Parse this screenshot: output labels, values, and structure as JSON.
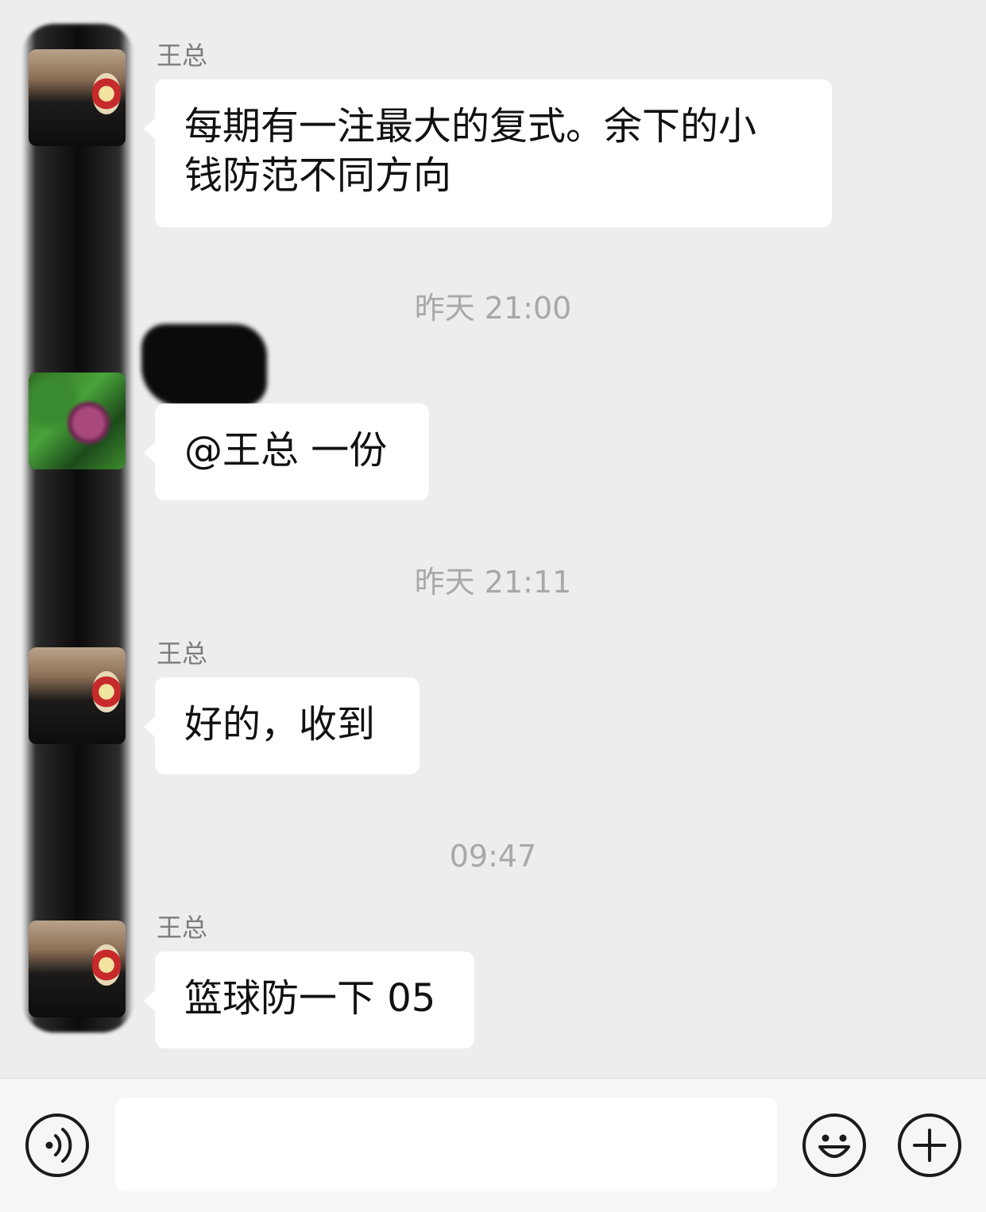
{
  "messages": [
    {
      "sender": "王总",
      "text_line1": "每期有一注最大的复式。余下的小",
      "text_line2": "钱防范不同方向"
    },
    {
      "time": "昨天 21:00"
    },
    {
      "text": "@王总 一份"
    },
    {
      "time": "昨天 21:11"
    },
    {
      "sender": "王总",
      "text": "好的，收到"
    },
    {
      "time": "09:47"
    },
    {
      "sender": "王总",
      "text": "篮球防一下 05"
    }
  ],
  "input_bar": {
    "input_value": "",
    "voice_icon": "voice-icon",
    "emoji_icon": "emoji-icon",
    "plus_icon": "plus-icon"
  }
}
